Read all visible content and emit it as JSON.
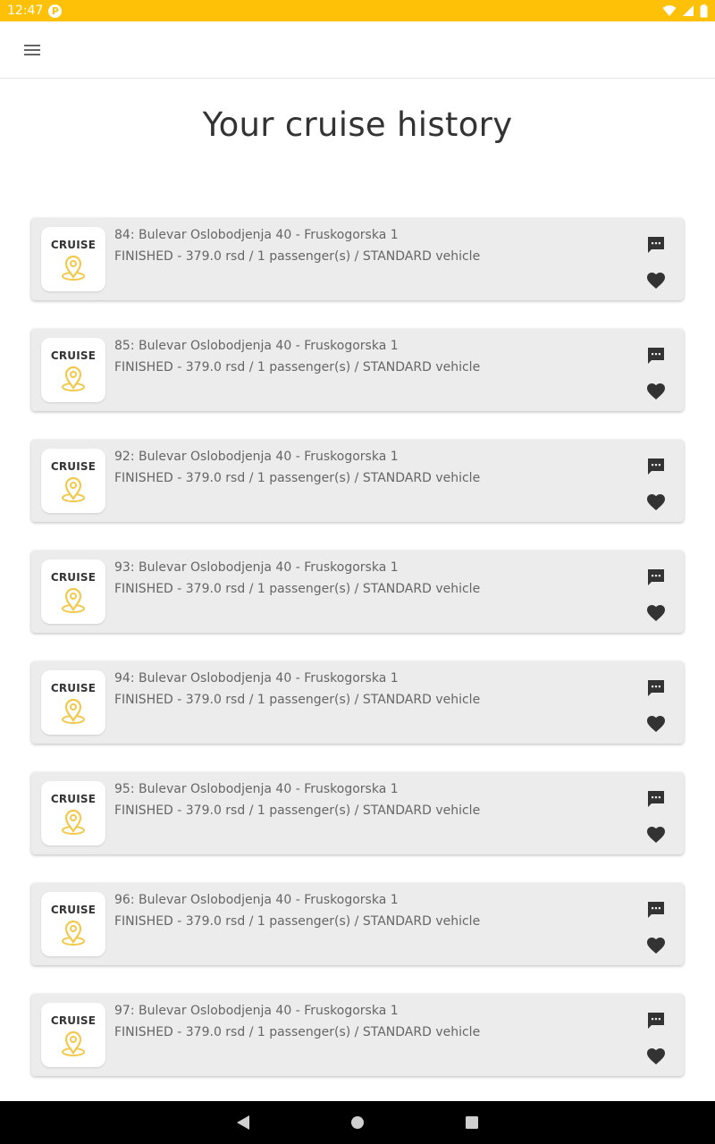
{
  "status_bar": {
    "time": "12:47",
    "badge_letter": "P",
    "icons": [
      "wifi-icon",
      "signal-icon",
      "battery-icon"
    ]
  },
  "app_bar": {
    "menu_icon": "hamburger-menu-icon"
  },
  "page": {
    "title": "Your cruise history"
  },
  "brand": {
    "logo_text": "CRUISE",
    "accent": "#FFC107",
    "pin_color": "#F2C94C"
  },
  "rides": [
    {
      "title": "84: Bulevar Oslobodjenja 40 - Fruskogorska 1",
      "details": "FINISHED - 379.0 rsd / 1 passenger(s) / STANDARD vehicle"
    },
    {
      "title": "85: Bulevar Oslobodjenja 40 - Fruskogorska 1",
      "details": "FINISHED - 379.0 rsd / 1 passenger(s) / STANDARD vehicle"
    },
    {
      "title": "92: Bulevar Oslobodjenja 40 - Fruskogorska 1",
      "details": "FINISHED - 379.0 rsd / 1 passenger(s) / STANDARD vehicle"
    },
    {
      "title": "93: Bulevar Oslobodjenja 40 - Fruskogorska 1",
      "details": "FINISHED - 379.0 rsd / 1 passenger(s) / STANDARD vehicle"
    },
    {
      "title": "94: Bulevar Oslobodjenja 40 - Fruskogorska 1",
      "details": "FINISHED - 379.0 rsd / 1 passenger(s) / STANDARD vehicle"
    },
    {
      "title": "95: Bulevar Oslobodjenja 40 - Fruskogorska 1",
      "details": "FINISHED - 379.0 rsd / 1 passenger(s) / STANDARD vehicle"
    },
    {
      "title": "96: Bulevar Oslobodjenja 40 - Fruskogorska 1",
      "details": "FINISHED - 379.0 rsd / 1 passenger(s) / STANDARD vehicle"
    },
    {
      "title": "97: Bulevar Oslobodjenja 40 - Fruskogorska 1",
      "details": "FINISHED - 379.0 rsd / 1 passenger(s) / STANDARD vehicle"
    }
  ],
  "card_icons": {
    "chat": "chat-bubble-icon",
    "favorite": "heart-icon"
  },
  "nav_bar": {
    "icons": [
      "back-icon",
      "home-icon",
      "recents-icon"
    ]
  }
}
